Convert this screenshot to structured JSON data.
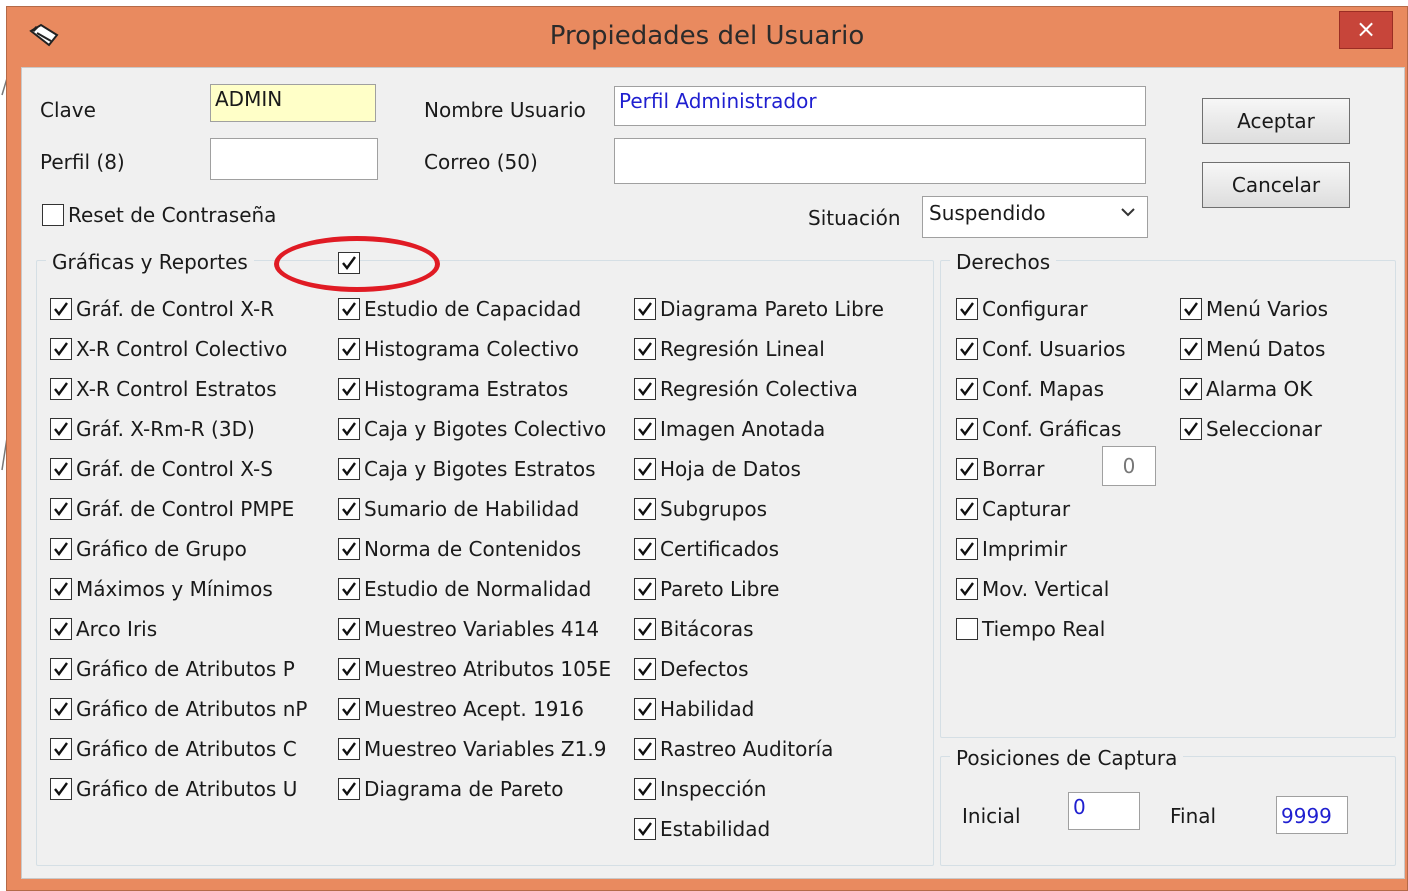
{
  "window": {
    "title": "Propiedades del Usuario",
    "close_label": "×",
    "accent": "#e98a5f"
  },
  "fields": {
    "clave_label": "Clave",
    "clave_value": "ADMIN",
    "perfil_label": "Perfil (8)",
    "perfil_value": "",
    "nombre_label": "Nombre Usuario",
    "nombre_value": "Perfil Administrador",
    "correo_label": "Correo (50)",
    "correo_value": "",
    "reset_label": "Reset de Contraseña",
    "reset_checked": false,
    "situacion_label": "Situación",
    "situacion_value": "Suspendido"
  },
  "buttons": {
    "aceptar": "Aceptar",
    "cancelar": "Cancelar"
  },
  "graficas": {
    "title": "Gráficas y Reportes",
    "all_checked": true,
    "col1": [
      {
        "label": "Gráf. de Control X-R",
        "checked": true
      },
      {
        "label": "X-R Control Colectivo",
        "checked": true
      },
      {
        "label": "X-R Control Estratos",
        "checked": true
      },
      {
        "label": "Gráf. X-Rm-R (3D)",
        "checked": true
      },
      {
        "label": "Gráf. de Control X-S",
        "checked": true
      },
      {
        "label": "Gráf. de Control PMPE",
        "checked": true
      },
      {
        "label": "Gráfico de Grupo",
        "checked": true
      },
      {
        "label": "Máximos y Mínimos",
        "checked": true
      },
      {
        "label": "Arco Iris",
        "checked": true
      },
      {
        "label": "Gráfico de Atributos P",
        "checked": true
      },
      {
        "label": "Gráfico de Atributos nP",
        "checked": true
      },
      {
        "label": "Gráfico de Atributos C",
        "checked": true
      },
      {
        "label": "Gráfico de Atributos U",
        "checked": true
      }
    ],
    "col2": [
      {
        "label": "Estudio de Capacidad",
        "checked": true
      },
      {
        "label": "Histograma Colectivo",
        "checked": true
      },
      {
        "label": "Histograma Estratos",
        "checked": true
      },
      {
        "label": "Caja y Bigotes Colectivo",
        "checked": true
      },
      {
        "label": "Caja y Bigotes Estratos",
        "checked": true
      },
      {
        "label": "Sumario de Habilidad",
        "checked": true
      },
      {
        "label": "Norma de Contenidos",
        "checked": true
      },
      {
        "label": "Estudio de Normalidad",
        "checked": true
      },
      {
        "label": "Muestreo Variables 414",
        "checked": true
      },
      {
        "label": "Muestreo Atributos 105E",
        "checked": true
      },
      {
        "label": "Muestreo Acept. 1916",
        "checked": true
      },
      {
        "label": "Muestreo Variables Z1.9",
        "checked": true
      },
      {
        "label": "Diagrama de Pareto",
        "checked": true
      }
    ],
    "col3": [
      {
        "label": "Diagrama Pareto Libre",
        "checked": true
      },
      {
        "label": "Regresión Lineal",
        "checked": true
      },
      {
        "label": "Regresión Colectiva",
        "checked": true
      },
      {
        "label": "Imagen Anotada",
        "checked": true
      },
      {
        "label": "Hoja de Datos",
        "checked": true
      },
      {
        "label": "Subgrupos",
        "checked": true
      },
      {
        "label": "Certificados",
        "checked": true
      },
      {
        "label": "Pareto Libre",
        "checked": true
      },
      {
        "label": "Bitácoras",
        "checked": true
      },
      {
        "label": "Defectos",
        "checked": true
      },
      {
        "label": "Habilidad",
        "checked": true
      },
      {
        "label": "Rastreo Auditoría",
        "checked": true
      },
      {
        "label": "Inspección",
        "checked": true
      },
      {
        "label": "Estabilidad",
        "checked": true
      }
    ]
  },
  "derechos": {
    "title": "Derechos",
    "col1": [
      {
        "label": "Configurar",
        "checked": true
      },
      {
        "label": "Conf. Usuarios",
        "checked": true
      },
      {
        "label": "Conf. Mapas",
        "checked": true
      },
      {
        "label": "Conf. Gráficas",
        "checked": true
      },
      {
        "label": "Borrar",
        "checked": true
      },
      {
        "label": "Capturar",
        "checked": true
      },
      {
        "label": "Imprimir",
        "checked": true
      },
      {
        "label": "Mov. Vertical",
        "checked": true
      },
      {
        "label": "Tiempo Real",
        "checked": false
      }
    ],
    "col2": [
      {
        "label": "Menú Varios",
        "checked": true
      },
      {
        "label": "Menú Datos",
        "checked": true
      },
      {
        "label": "Alarma OK",
        "checked": true
      },
      {
        "label": "Seleccionar",
        "checked": true
      }
    ],
    "borrar_value": "0"
  },
  "posiciones": {
    "title": "Posiciones de Captura",
    "inicial_label": "Inicial",
    "inicial_value": "0",
    "final_label": "Final",
    "final_value": "9999"
  }
}
